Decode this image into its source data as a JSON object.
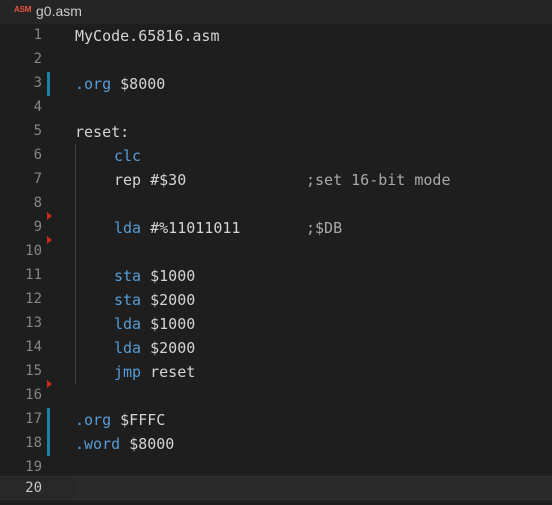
{
  "tab": {
    "icon_label": "ASM",
    "file_name": "g0.asm"
  },
  "colors": {
    "background": "#1e1e1e",
    "keyword": "#569cd6",
    "text": "#d4d4d4",
    "comment": "#a8a8a8",
    "line_number": "#858585",
    "modified_marker": "#1b81a8",
    "deleted_marker": "#c42b1c"
  },
  "editor": {
    "lines": [
      {
        "num": "1",
        "code": "MyCode.65816.asm",
        "comment": ""
      },
      {
        "num": "2",
        "code": "",
        "comment": ""
      },
      {
        "num": "3",
        "directive": ".org",
        "operand": "$8000",
        "comment": ""
      },
      {
        "num": "4",
        "code": "",
        "comment": ""
      },
      {
        "num": "5",
        "code": "reset:",
        "comment": ""
      },
      {
        "num": "6",
        "instr": "clc",
        "operand": "",
        "comment": ""
      },
      {
        "num": "7",
        "instr": "rep",
        "operand": "#$30",
        "comment": ";set 16-bit mode"
      },
      {
        "num": "8",
        "code": "",
        "comment": ""
      },
      {
        "num": "9",
        "instr": "lda",
        "operand": "#%11011011",
        "comment": ";$DB"
      },
      {
        "num": "10",
        "code": "",
        "comment": ""
      },
      {
        "num": "11",
        "instr": "sta",
        "operand": "$1000",
        "comment": ""
      },
      {
        "num": "12",
        "instr": "sta",
        "operand": "$2000",
        "comment": ""
      },
      {
        "num": "13",
        "instr": "lda",
        "operand": "$1000",
        "comment": ""
      },
      {
        "num": "14",
        "instr": "lda",
        "operand": "$2000",
        "comment": ""
      },
      {
        "num": "15",
        "instr": "jmp",
        "operand": "reset",
        "comment": ""
      },
      {
        "num": "16",
        "code": "",
        "comment": ""
      },
      {
        "num": "17",
        "directive": ".org",
        "operand": "$FFFC",
        "comment": ""
      },
      {
        "num": "18",
        "directive": ".word",
        "operand": "$8000",
        "comment": ""
      },
      {
        "num": "19",
        "code": "",
        "comment": ""
      },
      {
        "num": "20",
        "code": "",
        "comment": ""
      }
    ]
  }
}
